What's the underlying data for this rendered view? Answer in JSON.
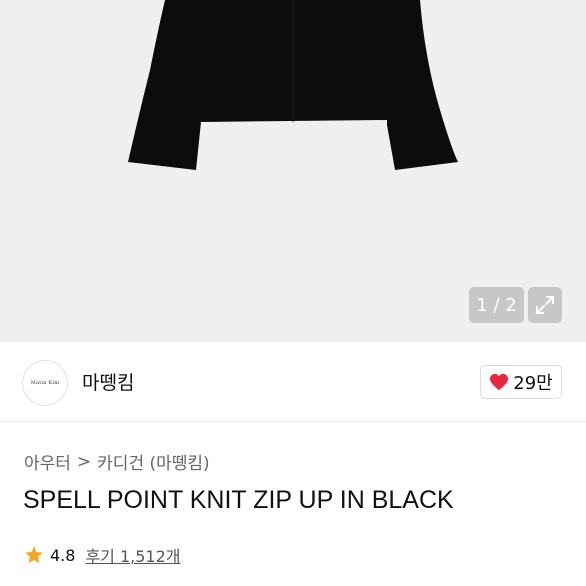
{
  "gallery": {
    "counter": "1 / 2"
  },
  "brand": {
    "logo_text": "Matin Kim",
    "name": "마뗑킴",
    "likes": "29만"
  },
  "breadcrumb": {
    "level1": "아우터",
    "separator": ">",
    "level2": "카디건 (마뗑킴)"
  },
  "product": {
    "title": "SPELL POINT KNIT ZIP UP IN BLACK",
    "rating": "4.8",
    "reviews": "후기 1,512개"
  },
  "colors": {
    "heart": "#e8263d",
    "star": "#f5a623",
    "hero_bg": "#efefef"
  }
}
